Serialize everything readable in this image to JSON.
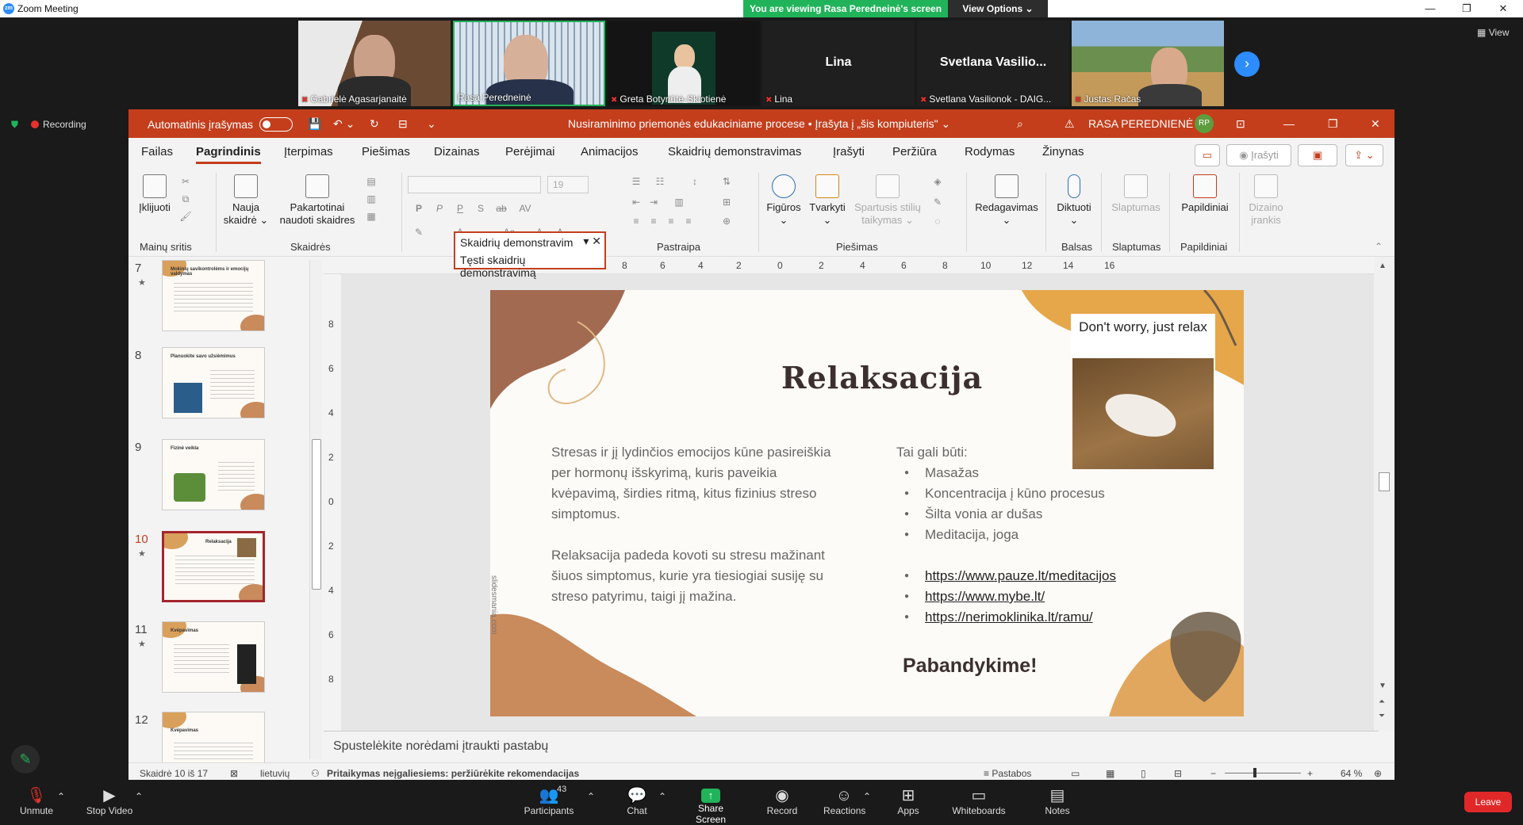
{
  "zoom": {
    "window_title": "Zoom Meeting",
    "viewing_banner": "You are viewing Rasa Peredneinė's screen",
    "view_options": "View Options",
    "view_button": "View",
    "recording": "Recording",
    "participants": [
      {
        "name": "Gabrielė Agasarjanaitė",
        "video": true
      },
      {
        "name": "Rasa Peredneinė",
        "video": true
      },
      {
        "name": "Greta Botyriūtė-Skiotienė",
        "video": true
      },
      {
        "name": "Lina",
        "video": false
      },
      {
        "name": "Svetlana Vasilionok - DAIG...",
        "big": "Svetlana  Vasilio...",
        "video": false
      },
      {
        "name": "Justas Račas",
        "video": true
      }
    ],
    "toolbar": {
      "unmute": "Unmute",
      "stop_video": "Stop Video",
      "participants": "Participants",
      "participants_count": "43",
      "chat": "Chat",
      "share_screen": "Share Screen",
      "record": "Record",
      "reactions": "Reactions",
      "apps": "Apps",
      "whiteboards": "Whiteboards",
      "notes": "Notes",
      "leave": "Leave"
    }
  },
  "ppt": {
    "autosave": "Automatinis įrašymas",
    "doc_title": "Nusiraminimo priemonės edukaciniame procese • Įrašyta į „šis kompiuteris\"",
    "user_name": "RASA PEREDNIENĖ",
    "user_initials": "RP",
    "tabs": [
      "Failas",
      "Pagrindinis",
      "Įterpimas",
      "Piešimas",
      "Dizainas",
      "Perėjimai",
      "Animacijos",
      "Skaidrių demonstravimas",
      "Įrašyti",
      "Peržiūra",
      "Rodymas",
      "Žinynas"
    ],
    "active_tab": "Pagrindinis",
    "record_btn": "Įrašyti",
    "ribbon": {
      "paste": "Įklijuoti",
      "new_slide": "Naujas skaidrė",
      "new_slide_1": "Nauja",
      "new_slide_2": "skaidrė",
      "reuse_1": "Pakartotinai",
      "reuse_2": "naudoti skaidres",
      "shapes": "Figūros",
      "arrange": "Tvarkyti",
      "styles_1": "Spartusis stilių",
      "styles_2": "taikymas",
      "editing": "Redagavimas",
      "dictate": "Diktuoti",
      "sensitivity": "Slaptumas",
      "addins": "Papildiniai",
      "designer_1": "Dizaino",
      "designer_2": "įrankis",
      "font_size": "19",
      "groups": [
        "Mainų sritis",
        "Skaidrės",
        "Pastraipa",
        "Piešimas",
        "Balsas",
        "Slaptumas",
        "Papildiniai"
      ]
    },
    "dropdown": {
      "line1": "Skaidrių demonstravim",
      "line2": "Tęsti skaidrių demonstravimą"
    },
    "thumbnails": [
      {
        "num": "7",
        "title": "Mokinių savikontrolėms ir emocijų valdymas"
      },
      {
        "num": "8",
        "title": "Planuokite savo užsiėmimus"
      },
      {
        "num": "9",
        "title": "Fizinė veikla"
      },
      {
        "num": "10",
        "title": "Relaksacija",
        "selected": true
      },
      {
        "num": "11",
        "title": "Kvėpavimas"
      },
      {
        "num": "12",
        "title": "Kvėpavimas"
      }
    ],
    "ruler_h": [
      "10",
      "8",
      "6",
      "4",
      "2",
      "0",
      "2",
      "4",
      "6",
      "8",
      "10",
      "12",
      "14",
      "16"
    ],
    "ruler_v": [
      "8",
      "6",
      "4",
      "2",
      "0",
      "2",
      "4",
      "6",
      "8"
    ],
    "slide": {
      "title": "Relaksacija",
      "para1": "Stresas ir jį lydinčios emocijos kūne pasireiškia per hormonų išskyrimą, kuris paveikia kvėpavimą, širdies ritmą, kitus fizinius streso simptomus.",
      "para2": "Relaksacija padeda kovoti su stresu mažinant šiuos simptomus, kurie yra tiesiogiai susiję su streso patyrimu, taigi jį mažina.",
      "list_intro": "Tai gali būti:",
      "list": [
        "Masažas",
        "Koncentracija į kūno procesus",
        "Šilta vonia ar dušas",
        "Meditacija, joga"
      ],
      "links": [
        "https://www.pauze.lt/meditacijos",
        "https://www.mybe.lt/",
        "https://nerimoklinika.lt/ramu/"
      ],
      "cta": "Pabandykime!",
      "gif_caption": "Don't worry, just relax",
      "watermark": "slidesmania.com"
    },
    "notes_placeholder": "Spustelėkite norėdami įtraukti pastabų",
    "status": {
      "slide_counter": "Skaidrė 10 iš 17",
      "language": "lietuvių",
      "accessibility": "Pritaikymas neįgaliesiems: peržiūrėkite rekomendacijas",
      "notes_btn": "Pastabos",
      "zoom": "64 %"
    }
  },
  "colors": {
    "ppt_accent": "#c43e1c",
    "zoom_green": "#21b35a",
    "zoom_blue": "#2d8cff",
    "leave_red": "#e02828"
  }
}
